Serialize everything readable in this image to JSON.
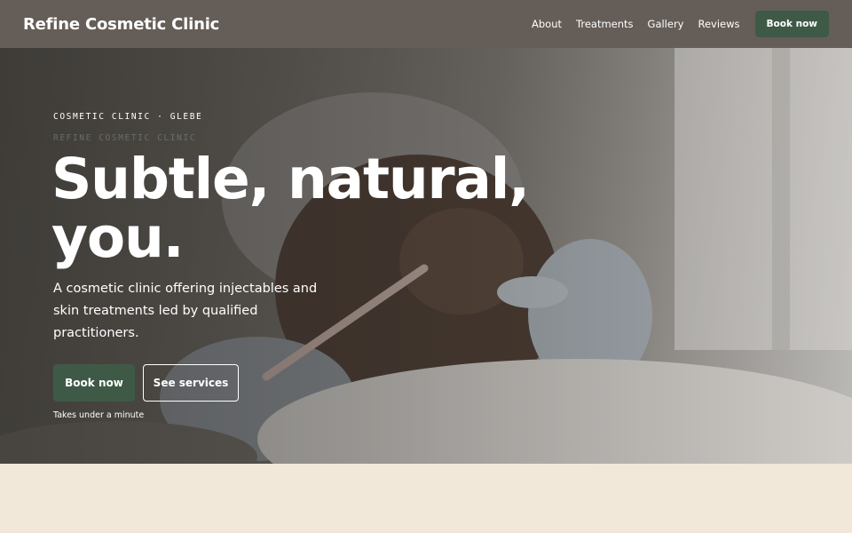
{
  "header": {
    "brand": "Refine Cosmetic Clinic",
    "nav": [
      "About",
      "Treatments",
      "Gallery",
      "Reviews"
    ],
    "book_label": "Book now"
  },
  "hero": {
    "eyebrow": "COSMETIC CLINIC · GLEBE",
    "ghost_text": "REFINE COSMETIC CLINIC",
    "headline_line1": "Subtle, natural,",
    "headline_line2": "you.",
    "subtitle": "A cosmetic clinic offering injectables and skin treatments led by qualified practitioners.",
    "primary_cta": "Book now",
    "secondary_cta": "See services",
    "note": "Takes under a minute"
  },
  "colors": {
    "header_bg": "#655d57",
    "accent_green": "#3e5a47",
    "page_bg": "#f1e8da"
  }
}
